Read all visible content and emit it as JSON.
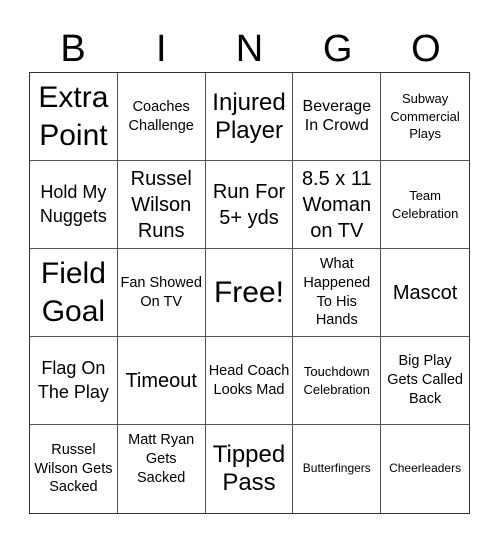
{
  "header": {
    "letters": [
      "B",
      "I",
      "N",
      "G",
      "O"
    ]
  },
  "grid": {
    "rows": [
      [
        "Extra Point",
        "Coaches Challenge",
        "Injured Player",
        "Beverage In Crowd",
        "Subway Commercial Plays"
      ],
      [
        "Hold My Nuggets",
        "Russel Wilson Runs",
        "Run For 5+ yds",
        "8.5 x 11 Woman on TV",
        "Team Celebration"
      ],
      [
        "Field Goal",
        "Fan Showed On TV",
        "Free!",
        "What Happened To His Hands",
        "Mascot"
      ],
      [
        "Flag On The Play",
        "Timeout",
        "Head Coach Looks Mad",
        "Touchdown Celebration",
        "Big Play Gets Called Back"
      ],
      [
        "Russel Wilson Gets Sacked",
        "Matt Ryan Gets Sacked",
        "Tipped Pass",
        "Butterfingers",
        "Cheerleaders"
      ]
    ],
    "free_space": "Free!"
  }
}
